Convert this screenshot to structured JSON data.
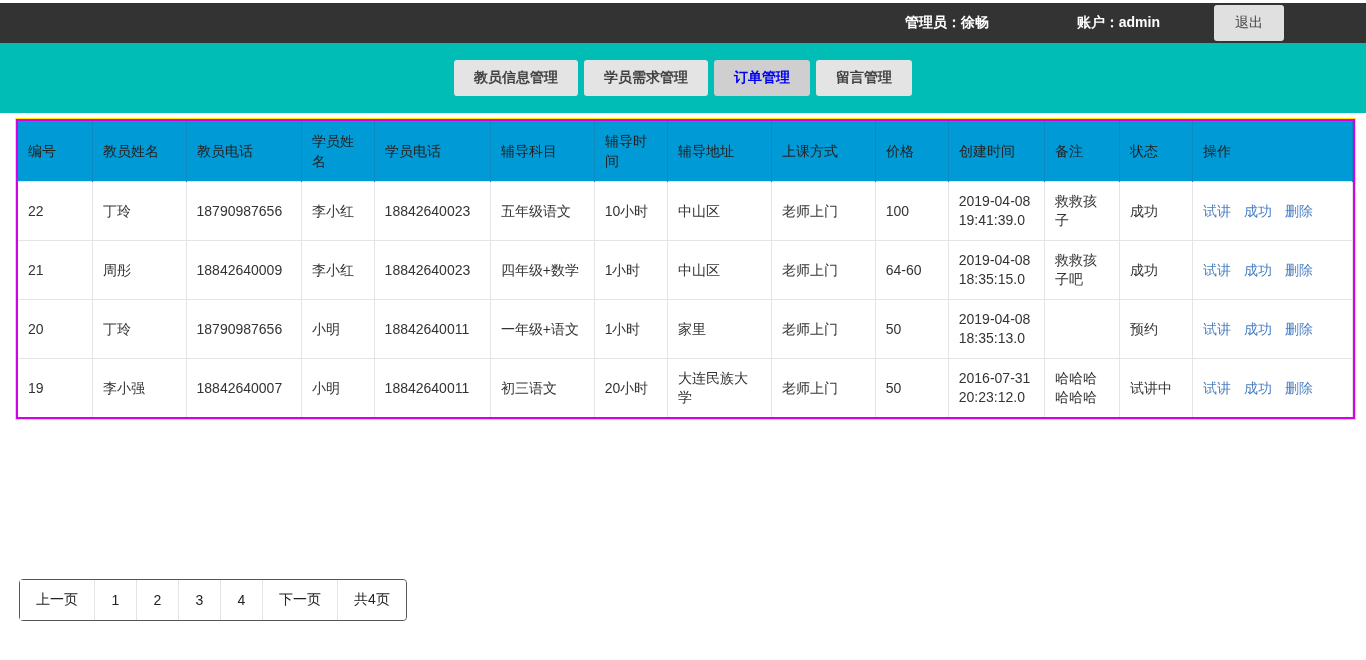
{
  "header": {
    "admin_label": "管理员：徐畅",
    "account_label": "账户：admin",
    "logout": "退出"
  },
  "tabs": [
    {
      "label": "教员信息管理",
      "selected": false
    },
    {
      "label": "学员需求管理",
      "selected": false
    },
    {
      "label": "订单管理",
      "selected": true
    },
    {
      "label": "留言管理",
      "selected": false
    }
  ],
  "table": {
    "columns": [
      "编号",
      "教员姓名",
      "教员电话",
      "学员姓名",
      "学员电话",
      "辅导科目",
      "辅导时间",
      "辅导地址",
      "上课方式",
      "价格",
      "创建时间",
      "备注",
      "状态",
      "操作"
    ],
    "rows": [
      {
        "cells": [
          "22",
          "丁玲",
          "18790987656",
          "李小红",
          "18842640023",
          "五年级语文",
          "10小时",
          "中山区",
          "老师上门",
          "100",
          "2019-04-08 19:41:39.0",
          "救救孩子",
          "成功"
        ],
        "actions": [
          "试讲",
          "成功",
          "删除"
        ]
      },
      {
        "cells": [
          "21",
          "周彤",
          "18842640009",
          "李小红",
          "18842640023",
          "四年级+数学",
          "1小时",
          "中山区",
          "老师上门",
          "64-60",
          "2019-04-08 18:35:15.0",
          "救救孩子吧",
          "成功"
        ],
        "actions": [
          "试讲",
          "成功",
          "删除"
        ]
      },
      {
        "cells": [
          "20",
          "丁玲",
          "18790987656",
          "小明",
          "18842640011",
          "一年级+语文",
          "1小时",
          "家里",
          "老师上门",
          "50",
          "2019-04-08 18:35:13.0",
          "",
          "预约"
        ],
        "actions": [
          "试讲",
          "成功",
          "删除"
        ]
      },
      {
        "cells": [
          "19",
          "李小强",
          "18842640007",
          "小明",
          "18842640011",
          "初三语文",
          "20小时",
          "大连民族大学",
          "老师上门",
          "50",
          "2016-07-31 20:23:12.0",
          "哈哈哈哈哈哈",
          "试讲中"
        ],
        "actions": [
          "试讲",
          "成功",
          "删除"
        ]
      }
    ]
  },
  "pagination": [
    "上一页",
    "1",
    "2",
    "3",
    "4",
    "下一页",
    "共4页"
  ]
}
